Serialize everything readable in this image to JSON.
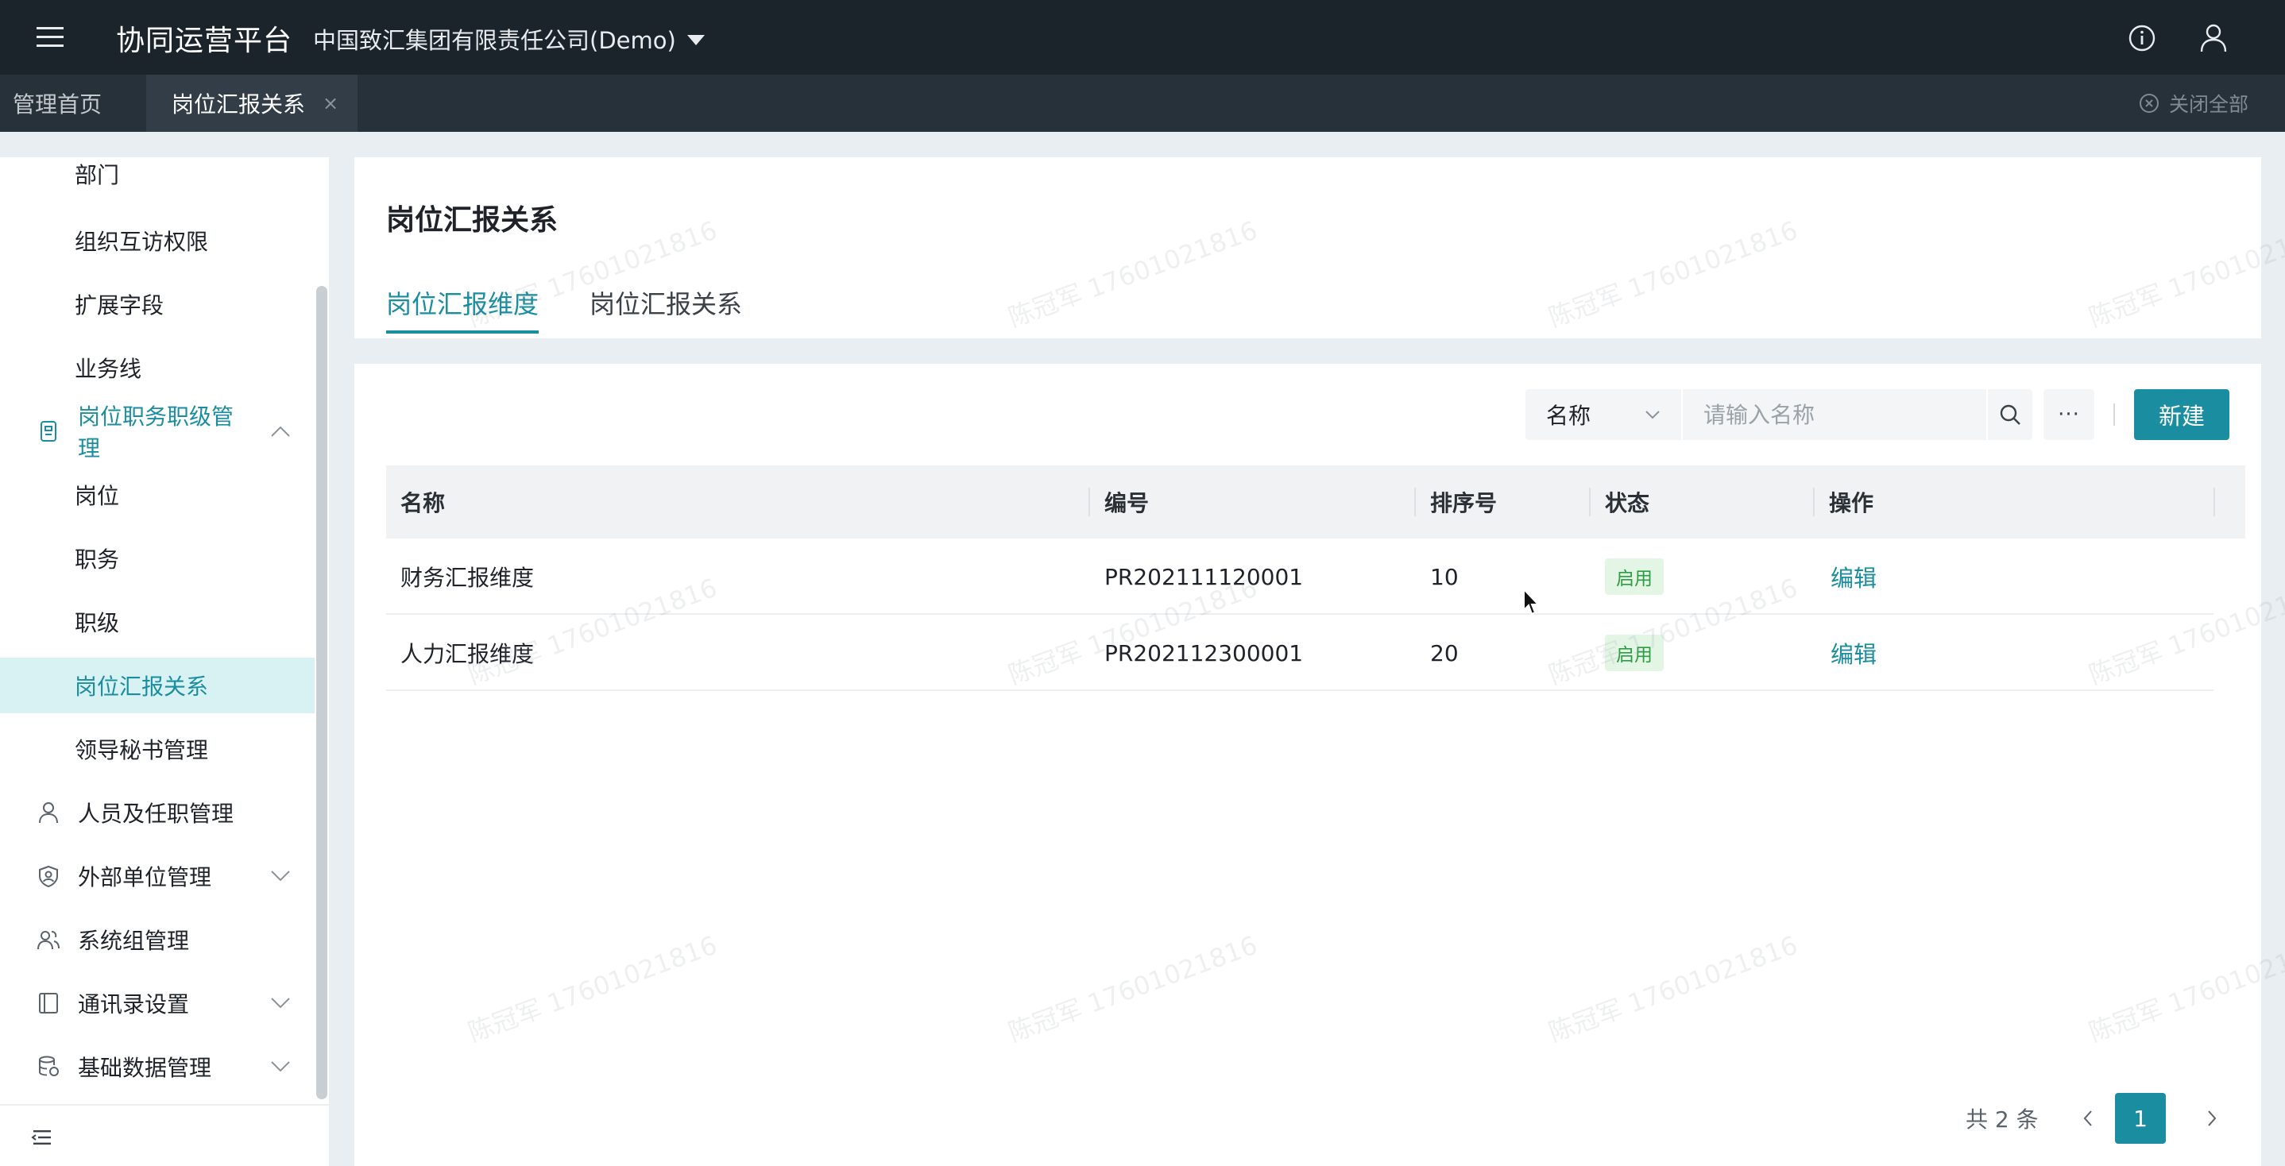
{
  "topbar": {
    "app_title": "协同运营平台",
    "company": "中国致汇集团有限责任公司(Demo)"
  },
  "tabs": {
    "home": "管理首页",
    "active": "岗位汇报关系",
    "close_symbol": "×",
    "close_all": "关闭全部"
  },
  "sidebar": {
    "items": [
      {
        "label": "部门"
      },
      {
        "label": "组织互访权限"
      },
      {
        "label": "扩展字段"
      },
      {
        "label": "业务线"
      },
      {
        "label": "岗位职务职级管理"
      },
      {
        "label": "岗位"
      },
      {
        "label": "职务"
      },
      {
        "label": "职级"
      },
      {
        "label": "岗位汇报关系"
      },
      {
        "label": "领导秘书管理"
      },
      {
        "label": "人员及任职管理"
      },
      {
        "label": "外部单位管理"
      },
      {
        "label": "系统组管理"
      },
      {
        "label": "通讯录设置"
      },
      {
        "label": "基础数据管理"
      }
    ]
  },
  "page": {
    "title": "岗位汇报关系",
    "sub_tabs": [
      "岗位汇报维度",
      "岗位汇报关系"
    ]
  },
  "toolbar": {
    "field_select": "名称",
    "search_placeholder": "请输入名称",
    "more_label": "···",
    "new_label": "新建"
  },
  "table": {
    "columns": [
      "名称",
      "编号",
      "排序号",
      "状态",
      "操作"
    ],
    "rows": [
      {
        "name": "财务汇报维度",
        "code": "PR202111120001",
        "order": "10",
        "status": "启用",
        "action": "编辑"
      },
      {
        "name": "人力汇报维度",
        "code": "PR202112300001",
        "order": "20",
        "status": "启用",
        "action": "编辑"
      }
    ]
  },
  "pagination": {
    "total": "共 2 条",
    "current": "1"
  },
  "watermark": {
    "text": "陈冠军 17601021816"
  },
  "colors": {
    "accent": "#1a8ea0",
    "topbar": "#1b232b",
    "status_green": "#2e9c44"
  }
}
